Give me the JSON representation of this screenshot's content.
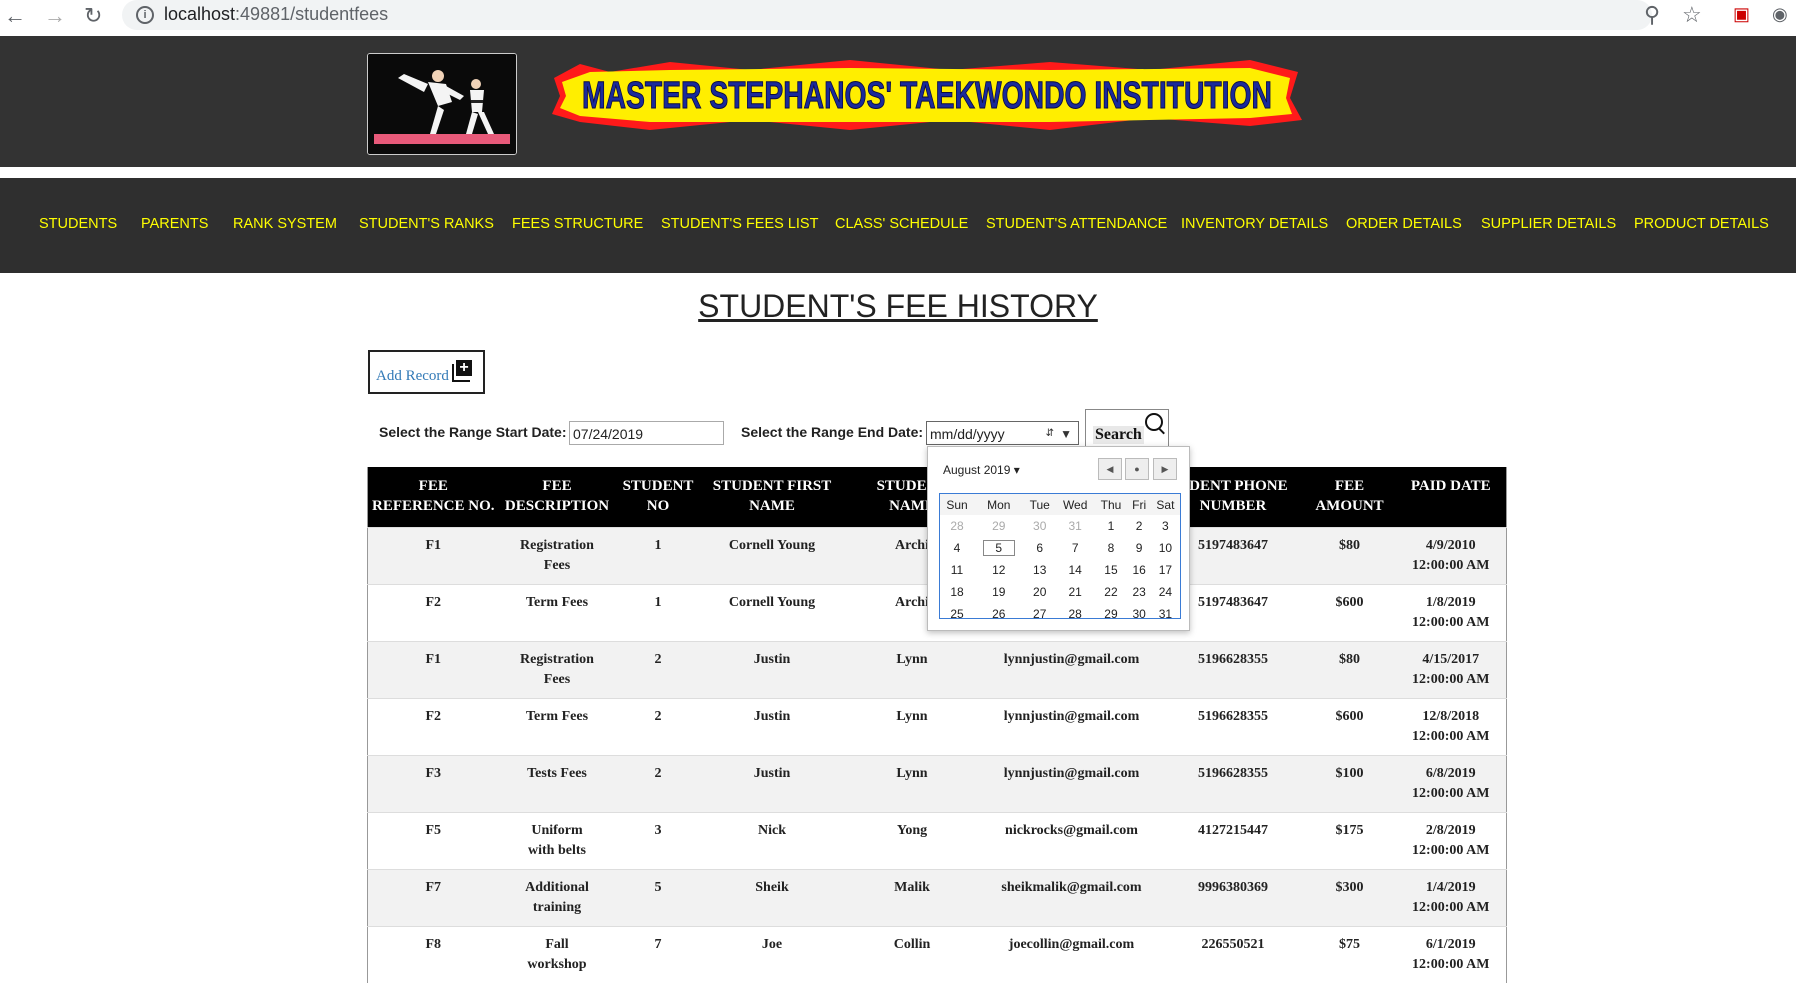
{
  "browser": {
    "url_host": "localhost",
    "url_path": ":49881/studentfees"
  },
  "header": {
    "banner_text": "MASTER STEPHANOS' TAEKWONDO INSTITUTION"
  },
  "nav": [
    "STUDENTS",
    "PARENTS",
    "RANK SYSTEM",
    "STUDENT'S RANKS",
    "FEES STRUCTURE",
    "STUDENT'S FEES LIST",
    "CLASS' SCHEDULE",
    "STUDENT'S ATTENDANCE",
    "INVENTORY DETAILS",
    "ORDER DETAILS",
    "SUPPLIER DETAILS",
    "PRODUCT DETAILS"
  ],
  "page": {
    "title": "STUDENT'S FEE HISTORY",
    "add_record_label": "Add Record",
    "start_label": "Select the Range Start Date:",
    "start_value": "07/24/2019",
    "end_label": "Select the Range End Date:",
    "end_placeholder": "mm/dd/yyyy",
    "search_label": "Search"
  },
  "table": {
    "headers": [
      [
        "FEE",
        "REFERENCE NO."
      ],
      [
        "FEE",
        "DESCRIPTION"
      ],
      [
        "STUDENT",
        "NO"
      ],
      [
        "STUDENT FIRST",
        "NAME"
      ],
      [
        "STUDENT",
        "NAME"
      ],
      [
        "",
        ""
      ],
      [
        "UDENT PHONE",
        "NUMBER"
      ],
      [
        "FEE",
        "AMOUNT"
      ],
      [
        "PAID DATE",
        ""
      ]
    ],
    "rows": [
      [
        "F1",
        "Registration Fees",
        "1",
        "Cornell Young",
        "Archi",
        "",
        "5197483647",
        "$80",
        "4/9/2010 12:00:00 AM"
      ],
      [
        "F2",
        "Term Fees",
        "1",
        "Cornell Young",
        "Archi",
        "",
        "5197483647",
        "$600",
        "1/8/2019 12:00:00 AM"
      ],
      [
        "F1",
        "Registration Fees",
        "2",
        "Justin",
        "Lynn",
        "lynnjustin@gmail.com",
        "5196628355",
        "$80",
        "4/15/2017 12:00:00 AM"
      ],
      [
        "F2",
        "Term Fees",
        "2",
        "Justin",
        "Lynn",
        "lynnjustin@gmail.com",
        "5196628355",
        "$600",
        "12/8/2018 12:00:00 AM"
      ],
      [
        "F3",
        "Tests Fees",
        "2",
        "Justin",
        "Lynn",
        "lynnjustin@gmail.com",
        "5196628355",
        "$100",
        "6/8/2019 12:00:00 AM"
      ],
      [
        "F5",
        "Uniform with belts",
        "3",
        "Nick",
        "Yong",
        "nickrocks@gmail.com",
        "4127215447",
        "$175",
        "2/8/2019 12:00:00 AM"
      ],
      [
        "F7",
        "Additional training",
        "5",
        "Sheik",
        "Malik",
        "sheikmalik@gmail.com",
        "9996380369",
        "$300",
        "1/4/2019 12:00:00 AM"
      ],
      [
        "F8",
        "Fall workshop",
        "7",
        "Joe",
        "Collin",
        "joecollin@gmail.com",
        "226550521",
        "$75",
        "6/1/2019 12:00:00 AM"
      ]
    ]
  },
  "datepicker": {
    "month_label": "August 2019",
    "weekdays": [
      "Sun",
      "Mon",
      "Tue",
      "Wed",
      "Thu",
      "Fri",
      "Sat"
    ],
    "weeks": [
      [
        "28",
        "29",
        "30",
        "31",
        "1",
        "2",
        "3"
      ],
      [
        "4",
        "5",
        "6",
        "7",
        "8",
        "9",
        "10"
      ],
      [
        "11",
        "12",
        "13",
        "14",
        "15",
        "16",
        "17"
      ],
      [
        "18",
        "19",
        "20",
        "21",
        "22",
        "23",
        "24"
      ],
      [
        "25",
        "26",
        "27",
        "28",
        "29",
        "30",
        "31"
      ]
    ],
    "today": "5"
  }
}
